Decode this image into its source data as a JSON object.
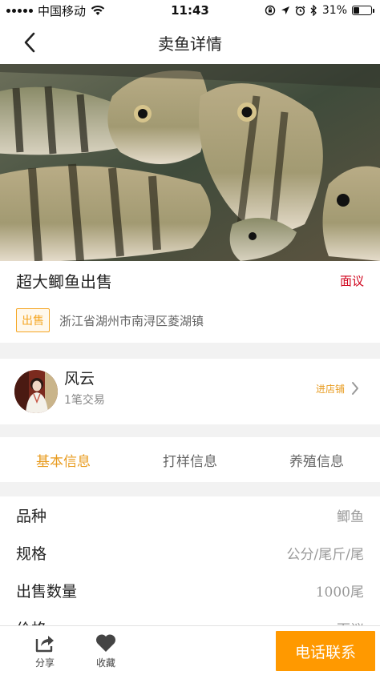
{
  "status_bar": {
    "carrier": "中国移动",
    "time": "11:43",
    "battery_percent": "31%",
    "battery_level": 0.31
  },
  "nav": {
    "title": "卖鱼详情",
    "back_icon": "chevron-left-icon"
  },
  "product": {
    "title": "超大鲫鱼出售",
    "price": "面议",
    "tag": "出售",
    "location": "浙江省湖州市南浔区菱湖镇"
  },
  "seller": {
    "name": "风云",
    "trades": "1笔交易",
    "shop_link": "进店铺"
  },
  "tabs": [
    {
      "label": "基本信息",
      "active": true
    },
    {
      "label": "打样信息",
      "active": false
    },
    {
      "label": "养殖信息",
      "active": false
    }
  ],
  "info": [
    {
      "label": "品种",
      "value": "鲫鱼"
    },
    {
      "label": "规格",
      "value": "公分/尾斤/尾"
    },
    {
      "label": "出售数量",
      "value": "1000尾"
    },
    {
      "label": "价格",
      "value": "面议"
    }
  ],
  "bottom_bar": {
    "share_label": "分享",
    "favorite_label": "收藏",
    "call_label": "电话联系"
  },
  "colors": {
    "accent": "#e89b1e",
    "price": "#d0021b",
    "call_button": "#ff9900"
  }
}
